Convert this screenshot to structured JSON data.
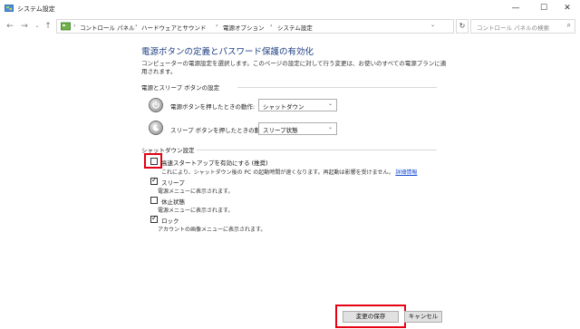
{
  "window": {
    "title": "システム設定",
    "min_glyph": "—",
    "max_glyph": "☐",
    "close_glyph": "✕"
  },
  "address_bar": {
    "back_glyph": "←",
    "forward_glyph": "→",
    "dropdown_glyph": "⌄",
    "up_glyph": "↑",
    "chevron_glyph": "›",
    "breadcrumb": [
      "コントロール パネル",
      "ハードウェアとサウンド",
      "電源オプション",
      "システム設定"
    ],
    "refresh_glyph": "↻",
    "search_placeholder": "コントロール パネルの検索",
    "search_glyph": "⌕"
  },
  "page": {
    "title": "電源ボタンの定義とパスワード保護の有効化",
    "description": "コンピューターの電源設定を選択します。このページの設定に対して行う変更は、お使いのすべての電源プランに適用されます。"
  },
  "power_section": {
    "heading": "電源とスリープ ボタンの設定",
    "power_button": {
      "label": "電源ボタンを押したときの動作:",
      "value": "シャットダウン",
      "icon": "power-button-icon"
    },
    "sleep_button": {
      "label": "スリープ ボタンを押したときの動作:",
      "value": "スリープ状態",
      "icon": "sleep-button-icon"
    },
    "select_chevron": "⌄"
  },
  "shutdown_section": {
    "heading": "シャットダウン設定",
    "fast_startup": {
      "label": "高速スタートアップを有効にする (推奨)",
      "checked": false,
      "desc": "これにより、シャットダウン後の PC の起動時間が速くなります。再起動は影響を受けません。",
      "link": "詳細情報"
    },
    "sleep": {
      "label": "スリープ",
      "checked": true,
      "desc": "電源メニューに表示されます。"
    },
    "hibernate": {
      "label": "休止状態",
      "checked": false,
      "desc": "電源メニューに表示されます。"
    },
    "lock": {
      "label": "ロック",
      "checked": true,
      "desc": "アカウントの画像メニューに表示されます。"
    },
    "check_glyph": "✓"
  },
  "buttons": {
    "save": "変更の保存",
    "cancel": "キャンセル"
  },
  "colors": {
    "title_blue": "#1e3e82",
    "link_blue": "#1a4fd6",
    "highlight_red": "#e60012"
  }
}
